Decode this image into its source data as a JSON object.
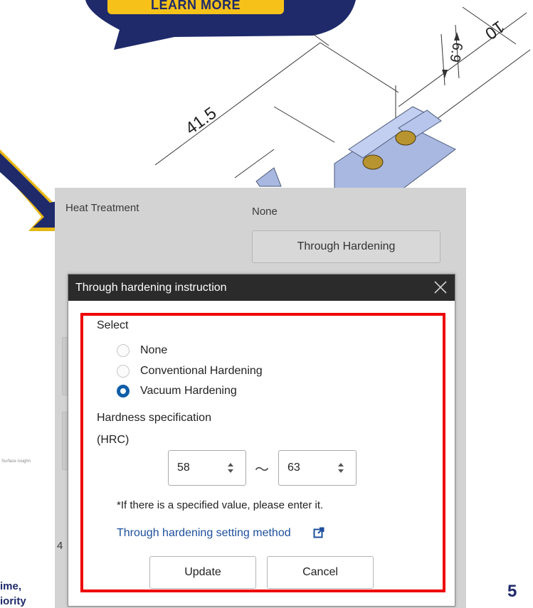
{
  "promo": {
    "learn_more_label": "LEARN MORE",
    "colors": {
      "banner": "#1f2a6b",
      "button": "#f6c21a"
    }
  },
  "drawing": {
    "dim_long": "41.5",
    "dim_width": "10",
    "dim_small": "6.9"
  },
  "form": {
    "heat_treatment_label": "Heat Treatment",
    "heat_treatment_value": "None",
    "through_hardening_button": "Through Hardening",
    "surface_fragment": "Surface roughn",
    "row_fragment": "4"
  },
  "modal": {
    "title": "Through hardening instruction",
    "close_icon": "close-icon",
    "select_label": "Select",
    "options": [
      {
        "label": "None",
        "checked": false
      },
      {
        "label": "Conventional Hardening",
        "checked": false
      },
      {
        "label": "Vacuum Hardening",
        "checked": true
      }
    ],
    "hardness_label": "Hardness specification",
    "hardness_unit": "(HRC)",
    "min_value": "58",
    "max_value": "63",
    "range_separator": "～",
    "note": "*If there is a specified value, please enter it.",
    "method_link": "Through hardening setting method",
    "update_button": "Update",
    "cancel_button": "Cancel",
    "colors": {
      "accent": "#0f5ea8",
      "highlight": "#ee0000",
      "link": "#1d4f9c"
    }
  },
  "slide": {
    "left_text_1": "ime,",
    "left_text_2": "iority",
    "page_number": "5"
  }
}
